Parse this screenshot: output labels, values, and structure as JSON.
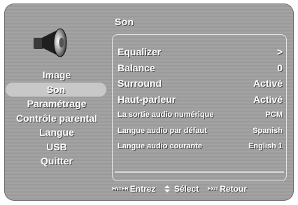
{
  "menu": {
    "title": "Son",
    "speaker_icon": "speaker-icon"
  },
  "sidebar": {
    "items": [
      {
        "label": "Image"
      },
      {
        "label": "Son"
      },
      {
        "label": "Paramétrage"
      },
      {
        "label": "Contrôle parental"
      },
      {
        "label": "Langue"
      },
      {
        "label": "USB"
      },
      {
        "label": "Quitter"
      }
    ],
    "selected_index": 1
  },
  "settings": {
    "rows": [
      {
        "label": "Equalizer",
        "value": ">"
      },
      {
        "label": "Balance",
        "value": "0"
      },
      {
        "label": "Surround",
        "value": "Activé"
      },
      {
        "label": "Haut-parleur",
        "value": "Activé"
      },
      {
        "label": "La sortie audio numérique",
        "value": "PCM"
      },
      {
        "label": "Langue audio par défaut",
        "value": "Spanish"
      },
      {
        "label": "Langue audio courante",
        "value": "English 1"
      }
    ]
  },
  "footer": {
    "enter_key": "ENTER",
    "enter_label": "Entrez",
    "select_icon": "up-down-arrows-icon",
    "select_label": "Sélect",
    "exit_key": "EXIT",
    "exit_label": "Retour"
  },
  "colors": {
    "background": "#9a9a9a",
    "selected": "#c8c8c8",
    "text": "#ffffff"
  }
}
